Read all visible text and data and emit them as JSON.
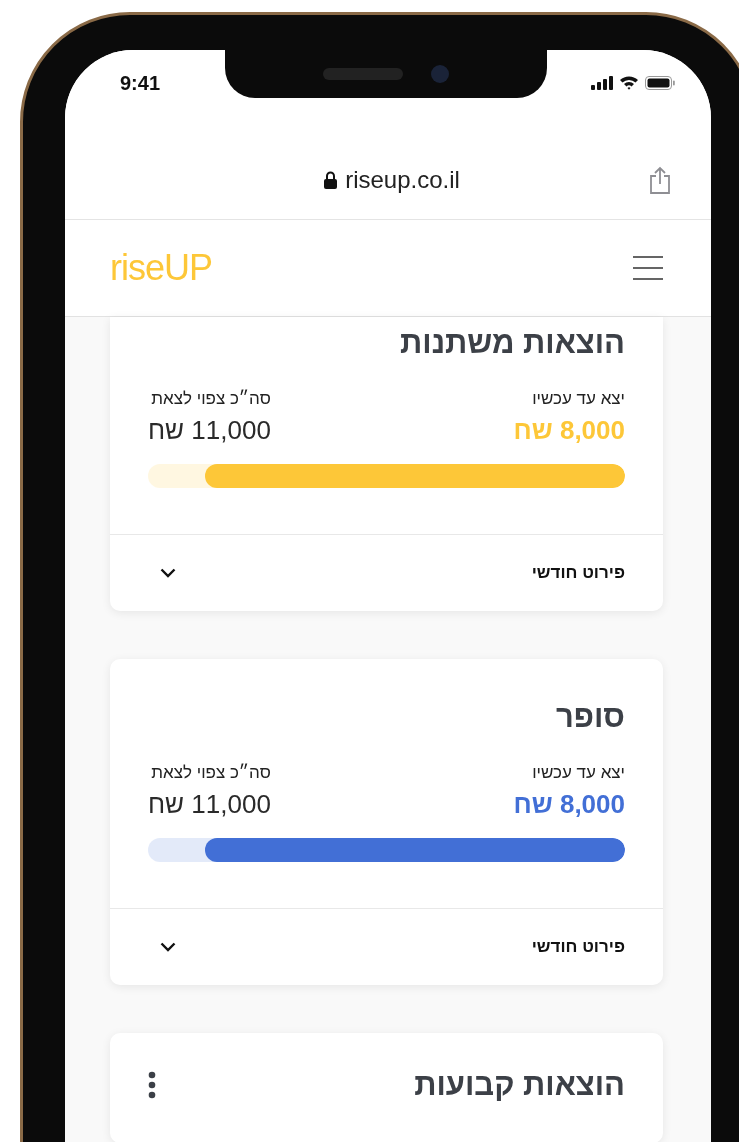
{
  "status_bar": {
    "time": "9:41"
  },
  "address_bar": {
    "url": "riseup.co.il"
  },
  "header": {
    "logo": "riseUP"
  },
  "cards": [
    {
      "kind": "progress",
      "title": "הוצאות משתנות",
      "spent_label": "יצא עד עכשיו",
      "spent": "8,000 שח",
      "total_label": "סה״כ צפוי לצאת",
      "total": "11,000 שח",
      "level": 0.88,
      "color": "#fdc738",
      "footer": "פירוט חודשי",
      "expanded": false
    },
    {
      "kind": "progress",
      "title": "סופר",
      "spent_label": "יצא עד עכשיו",
      "spent": "8,000 שח",
      "total_label": "סה״כ צפוי לצאת",
      "total": "11,000 שח",
      "level": 0.88,
      "color": "#426fd6",
      "footer": "פירוט חודשי",
      "expanded": false
    },
    {
      "kind": "summary",
      "title": "הוצאות קבועות"
    }
  ]
}
